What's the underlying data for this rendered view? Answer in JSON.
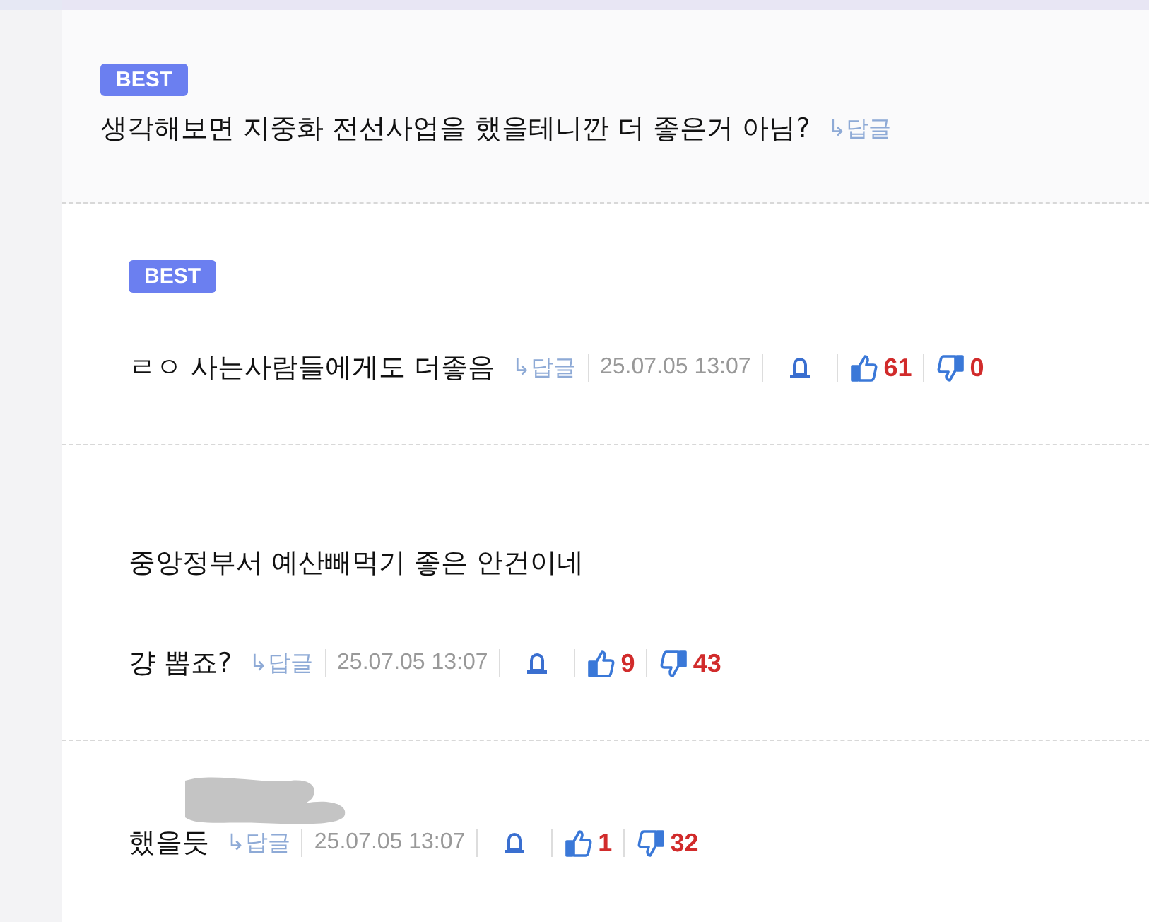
{
  "comments": [
    {
      "kind": "parent",
      "badge": "BEST",
      "lines": [
        "생각해보면 지중화 전선사업을 했을테니깐 더 좋은거 아님?"
      ],
      "reply": "↳답글"
    },
    {
      "kind": "reply",
      "badge": "BEST",
      "lines": [
        "ㄹㅇ 사는사람들에게도 더좋음"
      ],
      "reply": "↳답글",
      "date": "25.07.05 13:07",
      "likes": "61",
      "dislikes": "0"
    },
    {
      "kind": "reply",
      "lines": [
        "중앙정부서 예산빼먹기 좋은 안건이네",
        "걍 뽑죠?"
      ],
      "reply": "↳답글",
      "date": "25.07.05 13:07",
      "likes": "9",
      "dislikes": "43"
    },
    {
      "kind": "reply",
      "redacted": true,
      "lines": [
        "했을듯"
      ],
      "reply": "↳답글",
      "date": "25.07.05 13:07",
      "likes": "1",
      "dislikes": "32"
    }
  ]
}
